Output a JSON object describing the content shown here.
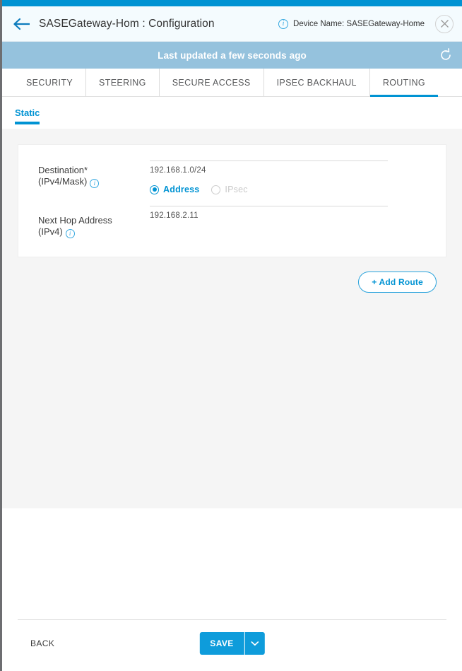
{
  "header": {
    "back_icon": "back-arrow-icon",
    "title": "SASEGateway-Hom : Configuration",
    "info_glyph": "i",
    "device_name": "Device Name: SASEGateway-Home",
    "close_glyph": "close-icon"
  },
  "status_strip": {
    "text": "Last updated a few seconds ago",
    "refresh_icon": "refresh-icon",
    "background": "#95c2dd"
  },
  "tabs": [
    {
      "label": "SECURITY",
      "active": false
    },
    {
      "label": "STEERING",
      "active": false
    },
    {
      "label": "SECURE ACCESS",
      "active": false
    },
    {
      "label": "IPSEC BACKHAUL",
      "active": false
    },
    {
      "label": "ROUTING",
      "active": true
    }
  ],
  "subtabs": [
    {
      "label": "Static",
      "active": true
    }
  ],
  "form": {
    "destination": {
      "label_line1": "Destination*",
      "label_line2": "(IPv4/Mask)",
      "info_glyph": "i",
      "value": "192.168.1.0/24"
    },
    "next_hop": {
      "label_line1": "Next Hop Address",
      "label_line2": "(IPv4)",
      "info_glyph": "i",
      "value": "192.168.2.11"
    },
    "next_hop_type": {
      "options": [
        {
          "label": "Address",
          "selected": true,
          "disabled": false
        },
        {
          "label": "IPsec",
          "selected": false,
          "disabled": true
        }
      ]
    }
  },
  "actions": {
    "add_route_label": "+ Add Route",
    "back_label": "BACK",
    "save_label": "SAVE",
    "save_caret_icon": "chevron-down-icon"
  },
  "colors": {
    "accent": "#0093d3",
    "strip": "#95c2dd",
    "save": "#0e9cdb",
    "content_bg": "#f5f5f5"
  }
}
